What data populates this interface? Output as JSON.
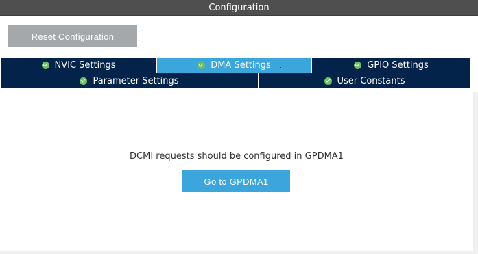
{
  "window": {
    "title": "Configuration"
  },
  "toolbar": {
    "reset_label": "Reset Configuration"
  },
  "tabs": [
    {
      "label": "NVIC Settings",
      "status_icon": "check-circle-icon",
      "active": false
    },
    {
      "label": "DMA Settings",
      "status_icon": "check-circle-icon",
      "active": true
    },
    {
      "label": "GPIO Settings",
      "status_icon": "check-circle-icon",
      "active": false
    },
    {
      "label": "Parameter Settings",
      "status_icon": "check-circle-icon",
      "active": false
    },
    {
      "label": "User Constants",
      "status_icon": "check-circle-icon",
      "active": false
    }
  ],
  "main": {
    "message": "DCMI requests should be configured in GPDMA1",
    "goto_label": "Go to GPDMA1"
  },
  "colors": {
    "titlebar": "#4f4f4f",
    "tab_inactive": "#03234b",
    "tab_active": "#3aa6db",
    "check": "#6dc067",
    "reset_button": "#a4a8ab",
    "goto_button": "#3ba5dc"
  }
}
